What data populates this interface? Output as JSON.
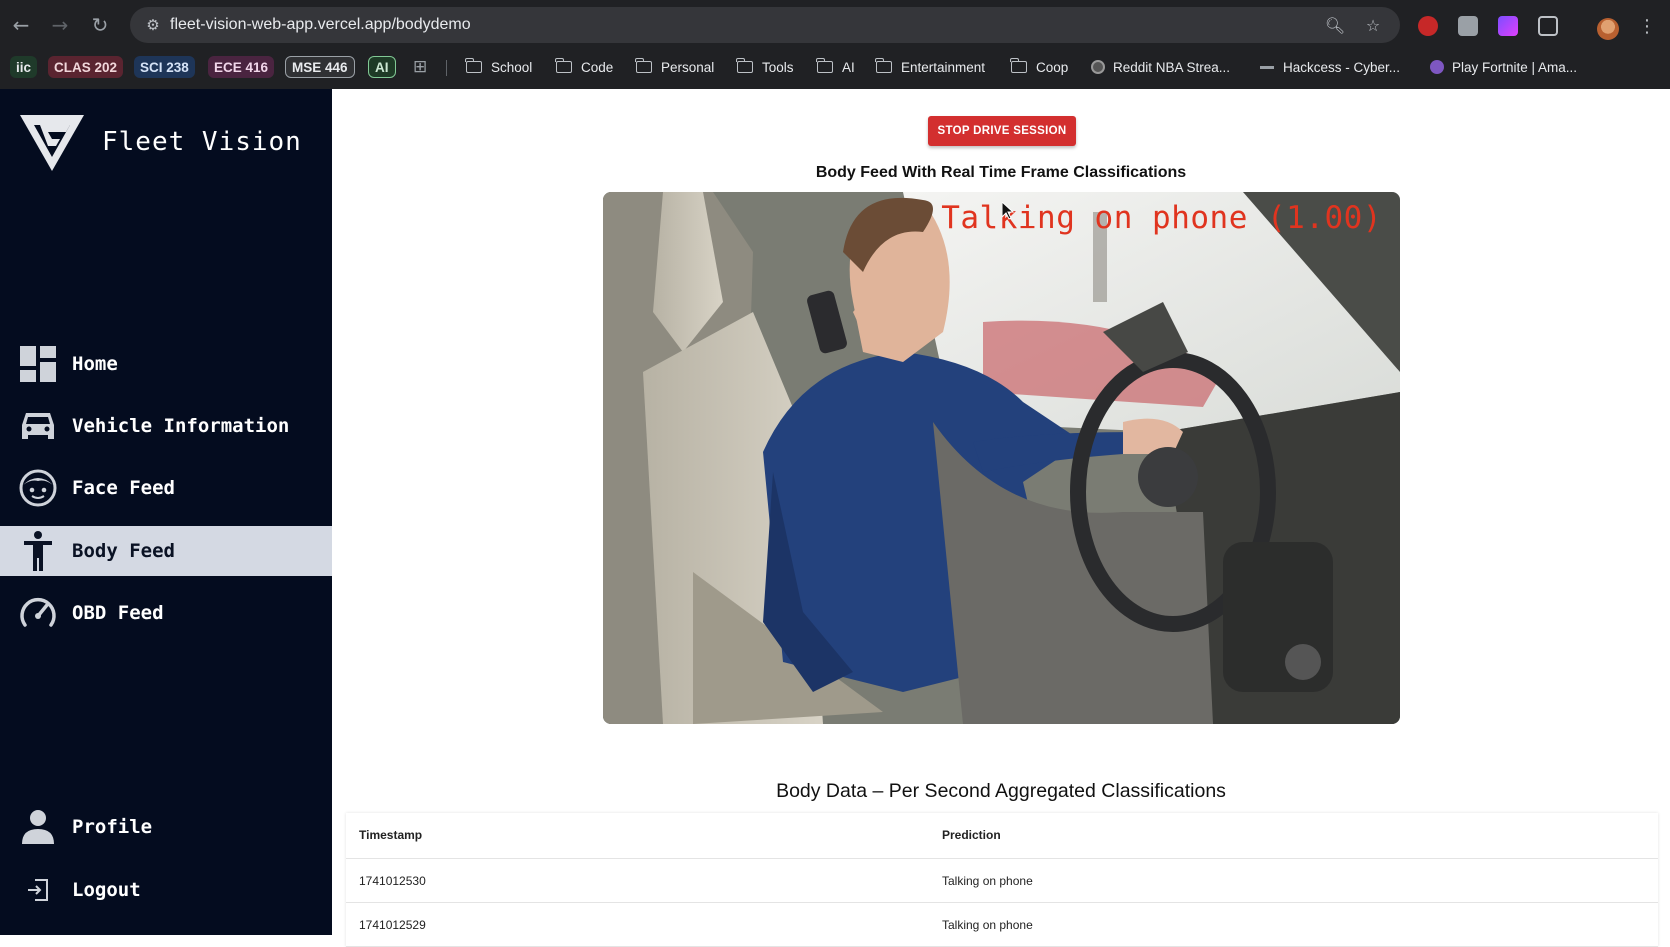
{
  "browser": {
    "url": "fleet-vision-web-app.vercel.app/bodydemo",
    "bookmarks": {
      "pills": [
        {
          "label": "iic",
          "bg": "#1f3a2a",
          "fg": "#e8eaed"
        },
        {
          "label": "CLAS 202",
          "bg": "#5a2430",
          "fg": "#f1d6da"
        },
        {
          "label": "SCI 238",
          "bg": "#1e3558",
          "fg": "#d5e2f6"
        },
        {
          "label": "ECE 416",
          "bg": "#4a2440",
          "fg": "#f1d6ea"
        },
        {
          "label": "MSE 446",
          "bg": "#303134",
          "fg": "#e8eaed"
        },
        {
          "label": "AI",
          "bg": "#1e3a26",
          "fg": "#cde8d3"
        }
      ],
      "folders": [
        "School",
        "Code",
        "Personal",
        "Tools",
        "AI",
        "Entertainment",
        "Coop"
      ],
      "links": [
        "Reddit NBA Strea...",
        "Hackcess - Cyber...",
        "Play Fortnite | Ama..."
      ]
    }
  },
  "sidebar": {
    "brand": "Fleet Vision",
    "items": [
      {
        "label": "Home",
        "icon": "dashboard-icon"
      },
      {
        "label": "Vehicle Information",
        "icon": "car-icon"
      },
      {
        "label": "Face Feed",
        "icon": "face-icon"
      },
      {
        "label": "Body Feed",
        "icon": "person-icon",
        "active": true
      },
      {
        "label": "OBD Feed",
        "icon": "speedometer-icon"
      }
    ],
    "bottom": [
      {
        "label": "Profile",
        "icon": "profile-icon"
      },
      {
        "label": "Logout",
        "icon": "logout-icon"
      }
    ]
  },
  "main": {
    "stop_button": "STOP DRIVE SESSION",
    "feed_title": "Body Feed With Real Time Frame Classifications",
    "overlay_label": "Talking on phone (1.00)",
    "data_title": "Body Data – Per Second Aggregated Classifications",
    "table": {
      "headers": [
        "Timestamp",
        "Prediction"
      ],
      "rows": [
        [
          "1741012530",
          "Talking on phone"
        ],
        [
          "1741012529",
          "Talking on phone"
        ]
      ]
    }
  },
  "colors": {
    "sidebar_bg": "#040c1f",
    "active_item_bg": "#d4d9e3",
    "stop_button": "#d32f2f",
    "overlay_text": "#e0341f"
  }
}
